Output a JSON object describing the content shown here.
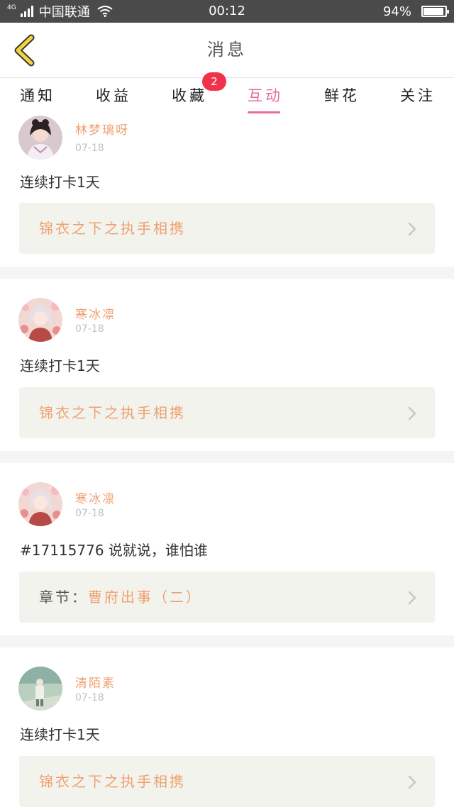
{
  "status_bar": {
    "network": "4G",
    "carrier": "中国联通",
    "time": "00:12",
    "battery_percent_label": "94%",
    "battery_level": 0.94
  },
  "header": {
    "title": "消息",
    "back_icon": "chevron-left-icon"
  },
  "tabs": [
    {
      "label": "通知",
      "active": false
    },
    {
      "label": "收益",
      "active": false
    },
    {
      "label": "收藏",
      "active": false,
      "badge": "2"
    },
    {
      "label": "互动",
      "active": true
    },
    {
      "label": "鲜花",
      "active": false
    },
    {
      "label": "关注",
      "active": false
    }
  ],
  "colors": {
    "accent": "#e86aa0",
    "username": "#f0a070",
    "badge": "#f0334a",
    "ref_background": "#f3f3ee"
  },
  "messages": [
    {
      "user": "林梦璃呀",
      "date": "07-18",
      "text": "连续打卡1天",
      "ref_prefix": "",
      "ref": "锦衣之下之执手相携"
    },
    {
      "user": "寒冰凛",
      "date": "07-18",
      "text": "连续打卡1天",
      "ref_prefix": "",
      "ref": "锦衣之下之执手相携"
    },
    {
      "user": "寒冰凛",
      "date": "07-18",
      "text": "#17115776 说就说，谁怕谁",
      "ref_prefix": "章节：",
      "ref": "曹府出事（二）"
    },
    {
      "user": "清陌素",
      "date": "07-18",
      "text": "连续打卡1天",
      "ref_prefix": "",
      "ref": "锦衣之下之执手相携"
    }
  ]
}
